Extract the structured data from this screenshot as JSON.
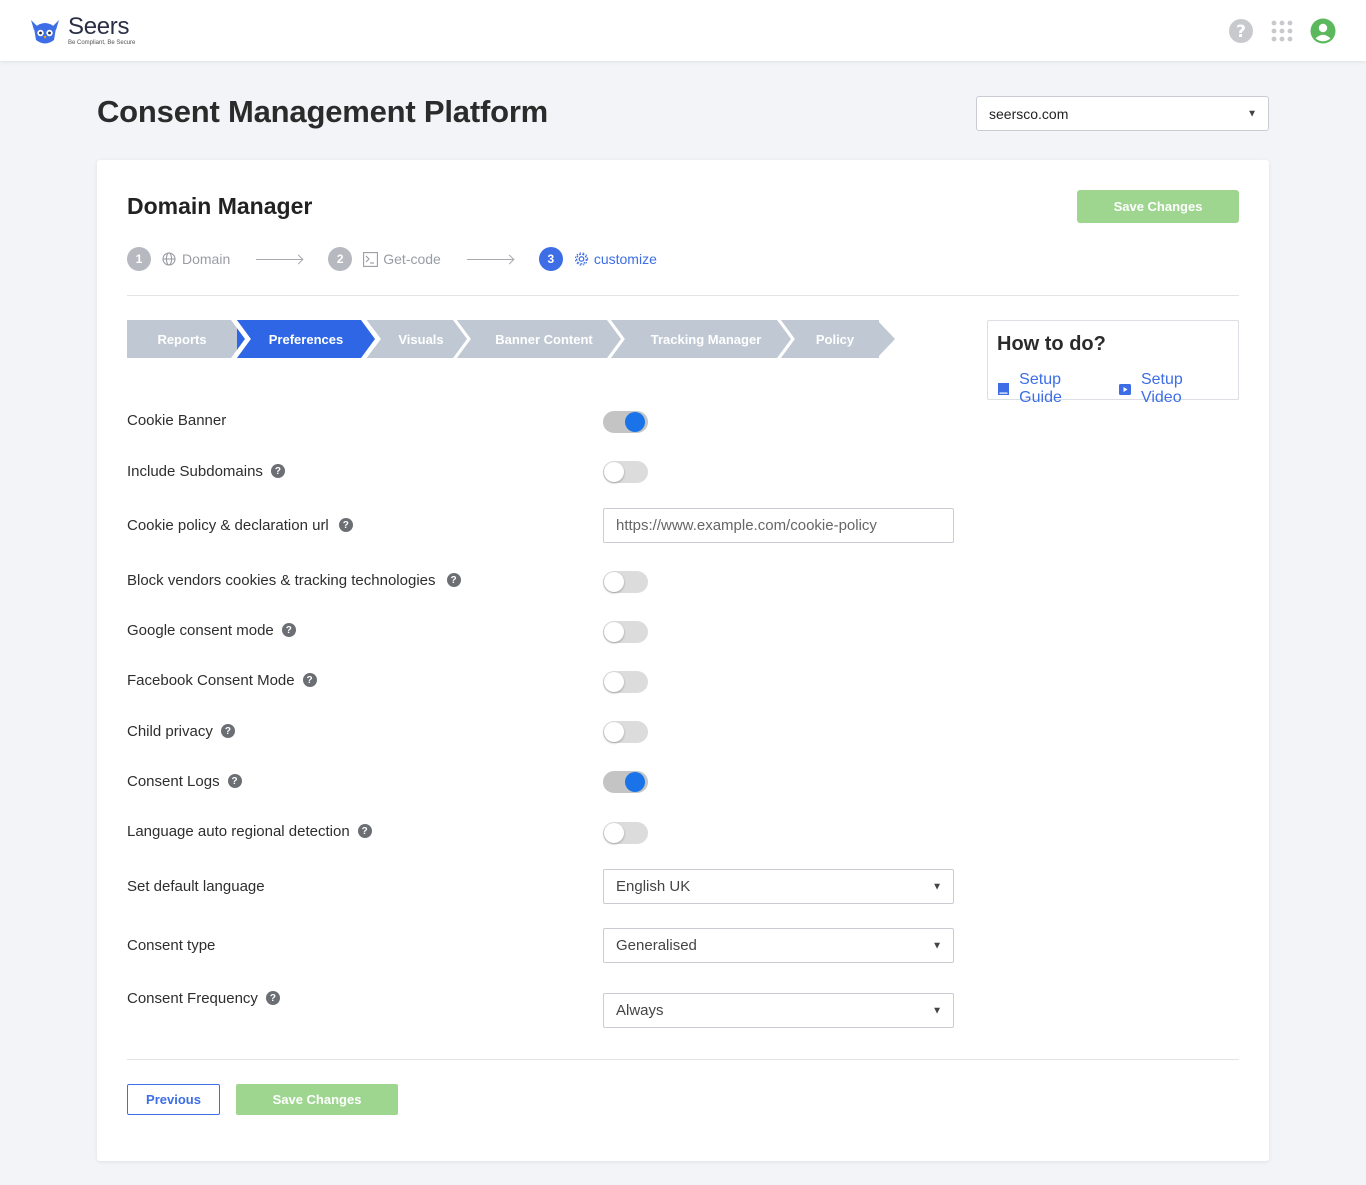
{
  "brand": {
    "name": "Seers",
    "tagline": "Be Compliant, Be Secure"
  },
  "header": {
    "title": "Consent Management Platform",
    "domain_selected": "seersco.com"
  },
  "top_icons": [
    "help-icon",
    "apps-grid-icon",
    "user-avatar-icon"
  ],
  "card": {
    "title": "Domain Manager",
    "save_label": "Save Changes",
    "steps": [
      {
        "num": "1",
        "label": "Domain",
        "icon": "globe-icon"
      },
      {
        "num": "2",
        "label": "Get-code",
        "icon": "terminal-icon"
      },
      {
        "num": "3",
        "label": "customize",
        "icon": "gear-icon"
      }
    ],
    "tabs": [
      "Reports",
      "Preferences",
      "Visuals",
      "Banner Content",
      "Tracking Manager",
      "Policy"
    ],
    "active_tab": "Preferences"
  },
  "howto": {
    "title": "How to do?",
    "guide": "Setup Guide",
    "video": "Setup Video"
  },
  "settings": {
    "cookie_banner": {
      "label": "Cookie Banner",
      "on": true
    },
    "include_subdomains": {
      "label": "Include Subdomains",
      "on": false
    },
    "cookie_policy_url": {
      "label": "Cookie policy & declaration url",
      "placeholder": "https://www.example.com/cookie-policy"
    },
    "block_vendors": {
      "label": "Block vendors cookies & tracking technologies",
      "on": false
    },
    "google_consent": {
      "label": "Google consent mode",
      "on": false
    },
    "facebook_consent": {
      "label": "Facebook Consent Mode",
      "on": false
    },
    "child_privacy": {
      "label": "Child privacy",
      "on": false
    },
    "consent_logs": {
      "label": "Consent Logs",
      "on": true
    },
    "language_detection": {
      "label": "Language auto regional detection",
      "on": false
    },
    "default_language": {
      "label": "Set default language",
      "value": "English UK"
    },
    "consent_type": {
      "label": "Consent type",
      "value": "Generalised"
    },
    "consent_frequency": {
      "label": "Consent Frequency",
      "value": "Always"
    }
  },
  "footer": {
    "previous_label": "Previous",
    "save_label": "Save Changes"
  },
  "colors": {
    "primary": "#2f66e6",
    "save_green": "#9ed690",
    "toggle_on": "#1a73e8"
  }
}
